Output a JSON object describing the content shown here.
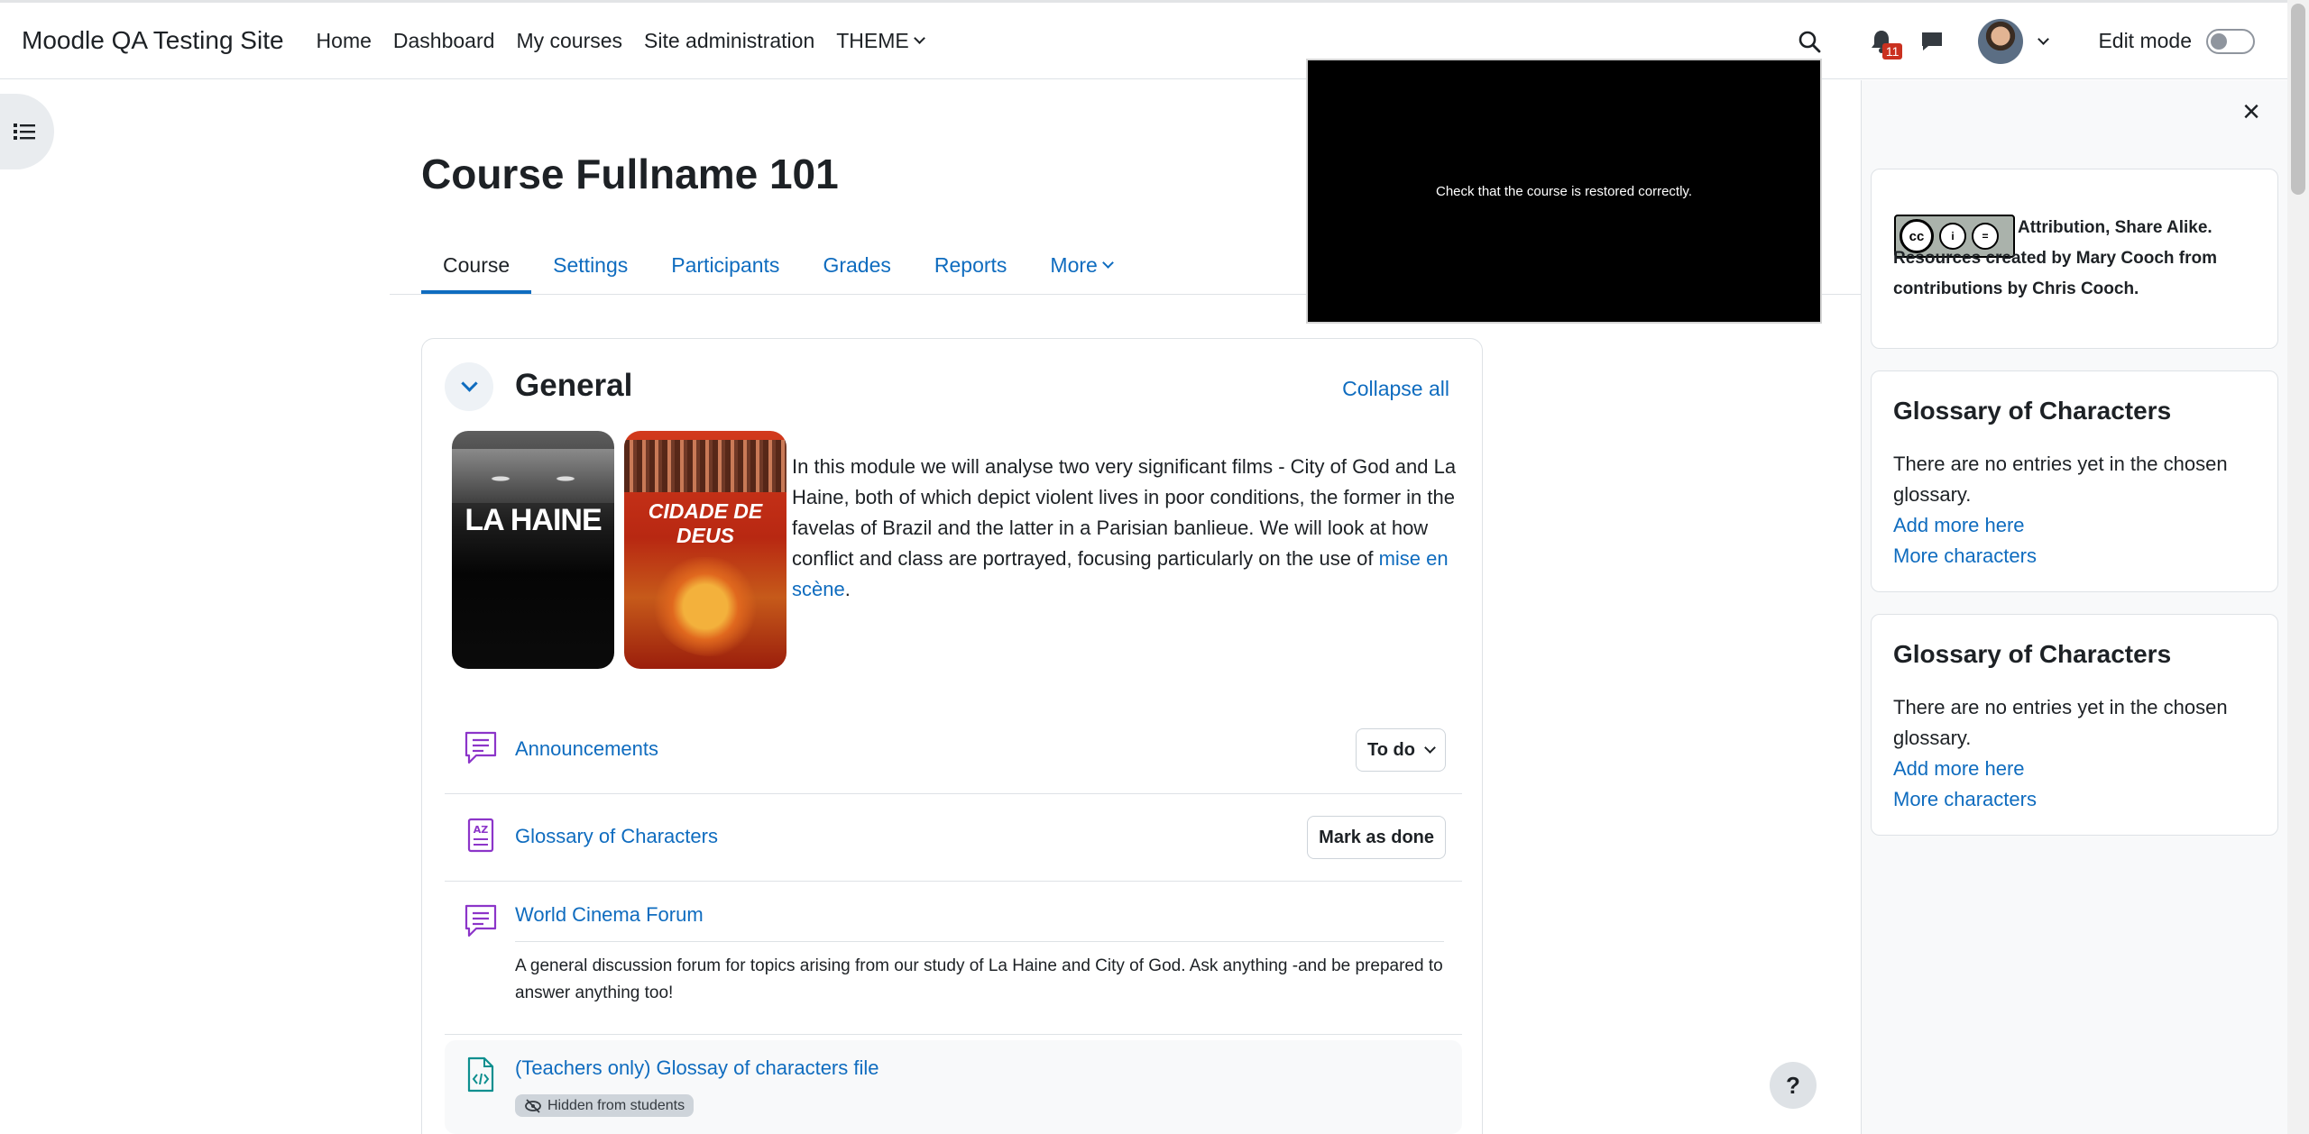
{
  "navbar": {
    "brand": "Moodle QA Testing Site",
    "links": [
      "Home",
      "Dashboard",
      "My courses",
      "Site administration"
    ],
    "theme_label": "THEME",
    "notification_count": "11",
    "edit_mode_label": "Edit mode",
    "icons": [
      "search-icon",
      "bell-icon",
      "chat-icon",
      "avatar",
      "chevron-down-icon"
    ]
  },
  "course": {
    "title": "Course Fullname 101",
    "tabs": [
      "Course",
      "Settings",
      "Participants",
      "Grades",
      "Reports",
      "More"
    ],
    "active_tab": "Course"
  },
  "section": {
    "title": "General",
    "collapse_all": "Collapse all",
    "intro_text": "In this module we will analyse two very significant films - City of God and La Haine, both of which depict violent lives in poor conditions, the former in the favelas of Brazil and the latter in a Parisian banlieue. We will look at how conflict and class are portrayed, focusing particularly on the use of ",
    "intro_link": "mise en scène",
    "intro_end": ".",
    "poster_haine_title": "LA HAINE",
    "poster_cidade_title": "CIDADE DE DEUS"
  },
  "activities": [
    {
      "name": "Announcements",
      "button": "To do",
      "icon": "forum-icon"
    },
    {
      "name": "Glossary of Characters",
      "button": "Mark as done",
      "icon": "glossary-icon"
    },
    {
      "name": "World Cinema Forum",
      "icon": "forum-icon",
      "description": "A general discussion forum for topics arising from our study of La Haine and City of God. Ask anything -and be prepared to answer anything too!"
    },
    {
      "name": "(Teachers only) Glossay of characters file",
      "icon": "file-code-icon",
      "badge": "Hidden from students"
    }
  ],
  "video": {
    "caption": "Check that the course is restored correctly."
  },
  "help": {
    "label": "?"
  },
  "drawer": {
    "close": "×",
    "license": "Attribution, Share Alike. Resources created by Mary Cooch from contributions by Chris Cooch.",
    "cc_badge": [
      "cc",
      "i",
      "="
    ],
    "blocks": [
      {
        "title": "Glossary of Characters",
        "body": "There are no entries yet in the chosen glossary.",
        "link1": "Add more here",
        "link2": "More characters"
      },
      {
        "title": "Glossary of Characters",
        "body": "There are no entries yet in the chosen glossary.",
        "link1": "Add more here",
        "link2": "More characters"
      }
    ]
  },
  "colors": {
    "link": "#0f6cbf",
    "text": "#1d2125",
    "activity_icon": "#8c35c9",
    "file_icon": "#0d8f8f"
  }
}
